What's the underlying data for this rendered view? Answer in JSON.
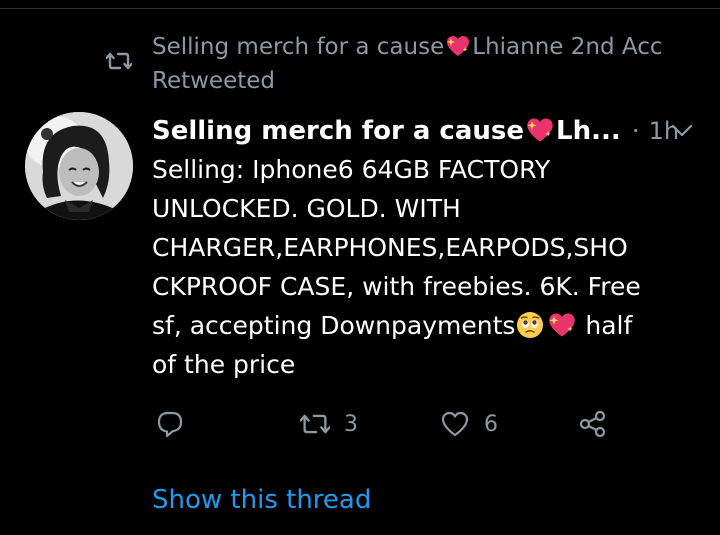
{
  "retweet_context": {
    "name_prefix": "Selling merch for a cause",
    "name_suffix": "Lhianne 2nd Acc",
    "action": "Retweeted"
  },
  "tweet": {
    "display_name_prefix": "Selling merch for a cause",
    "display_name_suffix": "Lh...",
    "separator": "·",
    "timestamp": "1h",
    "lines": [
      "Selling: Iphone6 64GB FACTORY",
      "UNLOCKED. GOLD. WITH",
      "CHARGER,EARPHONES,EARPODS,SHO",
      "CKPROOF CASE, with freebies. 6K. Free"
    ],
    "line5_prefix": "sf, accepting Downpayments",
    "line5_suffix": " half",
    "line6": "of the price"
  },
  "actions": {
    "reply_count": "",
    "retweet_count": "3",
    "like_count": "6"
  },
  "show_thread": "Show this thread",
  "colors": {
    "background": "#000000",
    "secondary_text": "#8b98a5",
    "link": "#1d9bf0",
    "heart_emoji": "#e8336f"
  },
  "icons": {
    "retweet_context": "retweet-icon",
    "reply": "reply-icon",
    "retweet": "retweet-icon",
    "like": "heart-icon",
    "share": "share-icon",
    "menu": "chevron-down-icon"
  }
}
